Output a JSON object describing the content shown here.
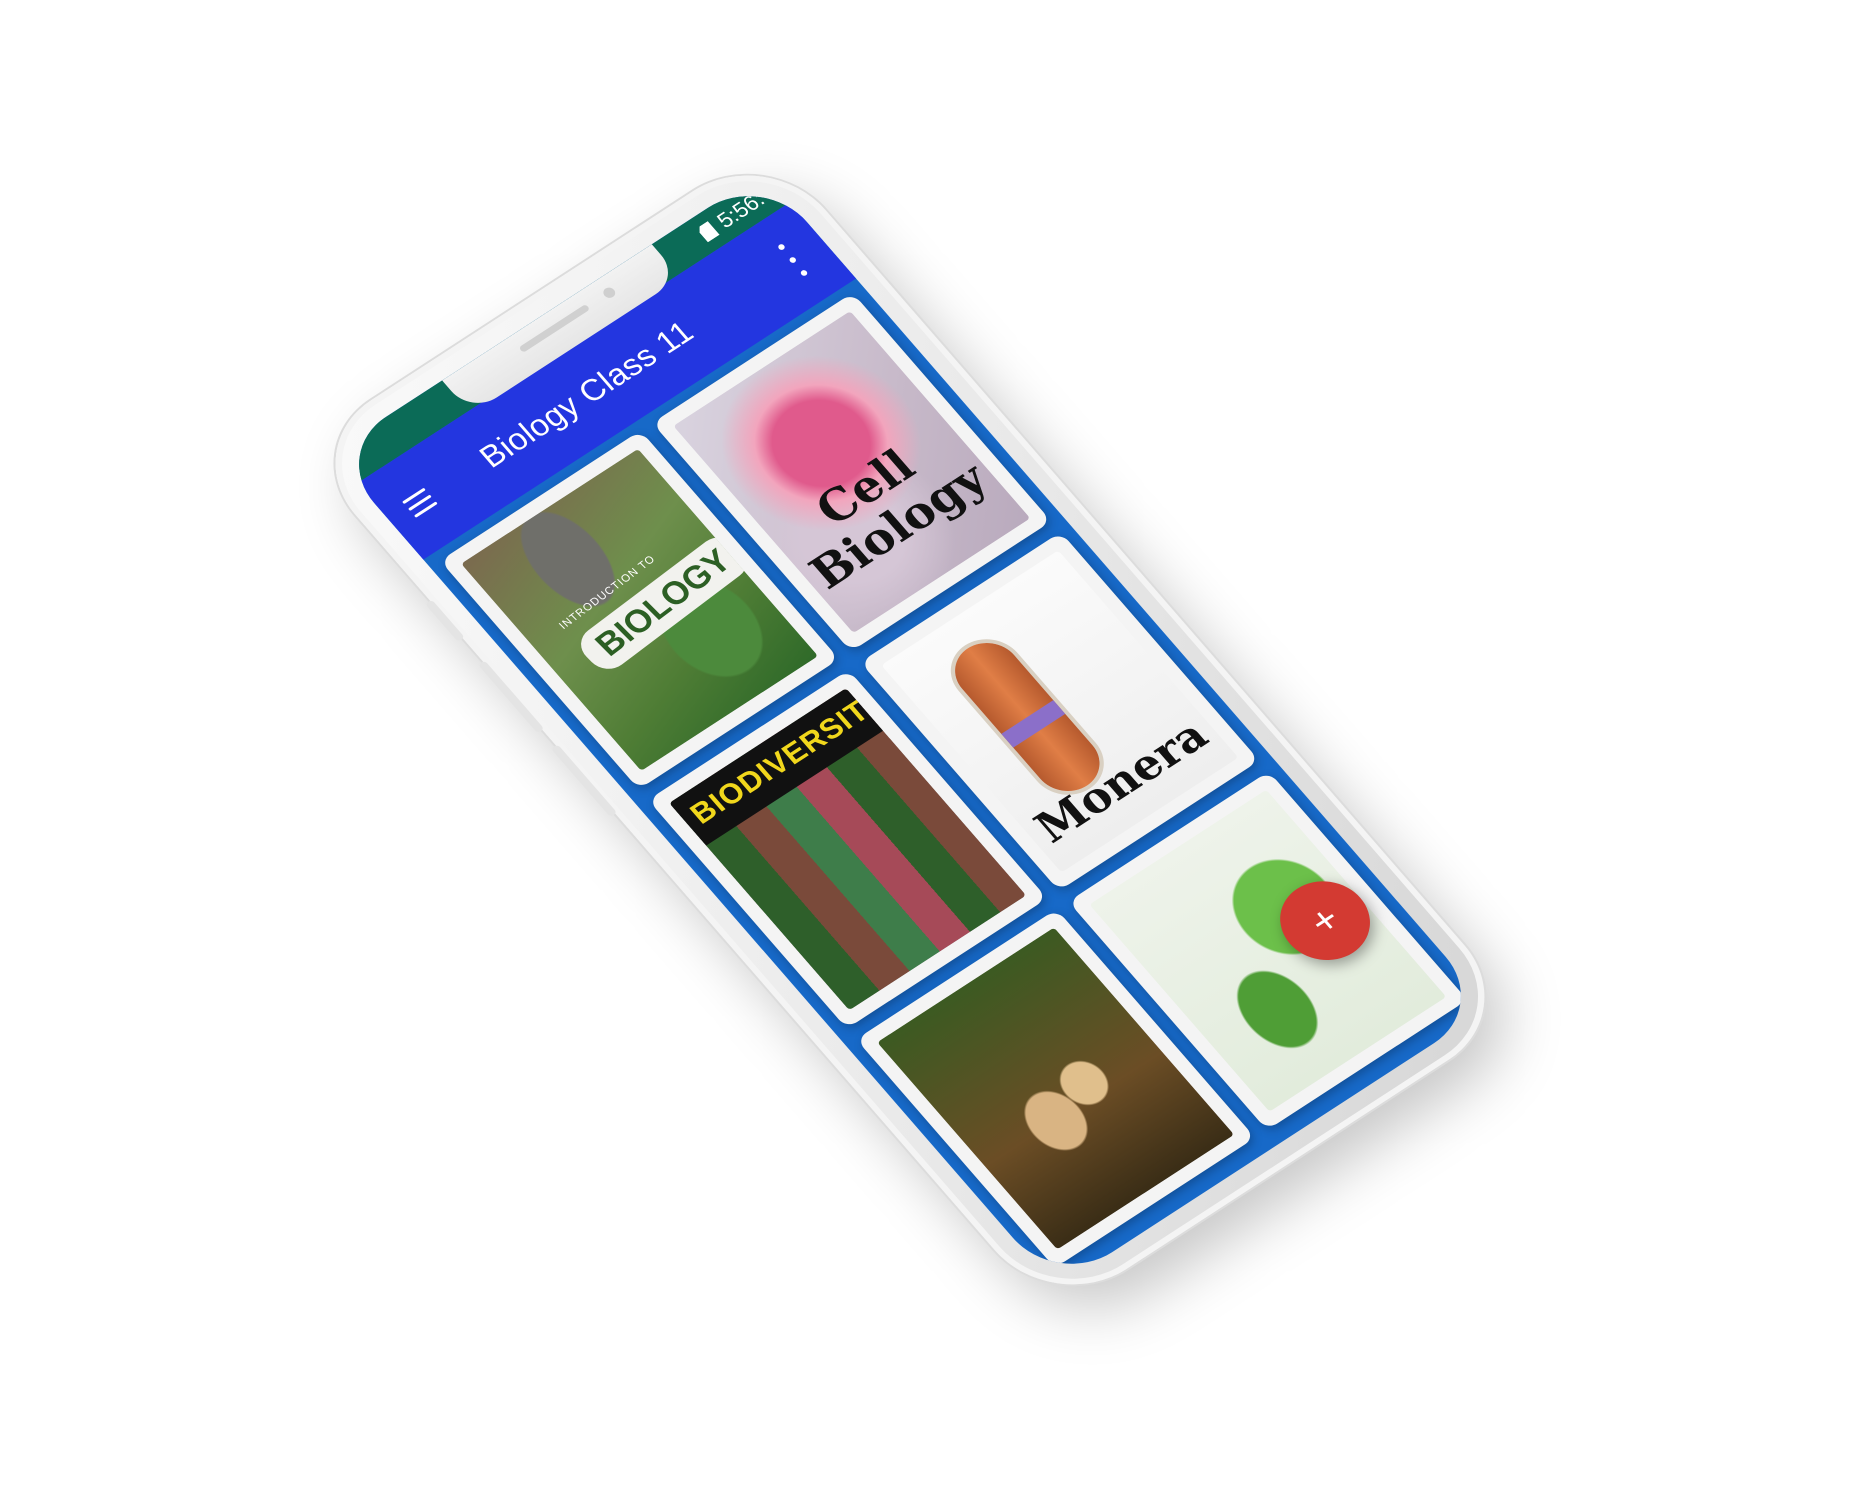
{
  "status_bar": {
    "time": "5:56:"
  },
  "app_bar": {
    "title": "Biology Class 11",
    "menu_icon": "hamburger-menu-icon",
    "overflow_icon": "more-vert-icon"
  },
  "cards": [
    {
      "name": "card-introduction-to-biology",
      "cover_text": "BIOLOGY",
      "cover_subtext": "INTRODUCTION TO"
    },
    {
      "name": "card-cell-biology",
      "cover_text": "Cell Biology"
    },
    {
      "name": "card-biodiversity",
      "cover_text": "BIODIVERSITY"
    },
    {
      "name": "card-monera",
      "cover_text": "Monera"
    },
    {
      "name": "card-fungi"
    },
    {
      "name": "card-plants"
    }
  ],
  "fab": {
    "label": "+",
    "icon": "add-icon",
    "color": "#d33a32"
  },
  "colors": {
    "app_bar": "#2336e0",
    "status_bar": "#0b6b57",
    "content_background": "#1769c8"
  }
}
